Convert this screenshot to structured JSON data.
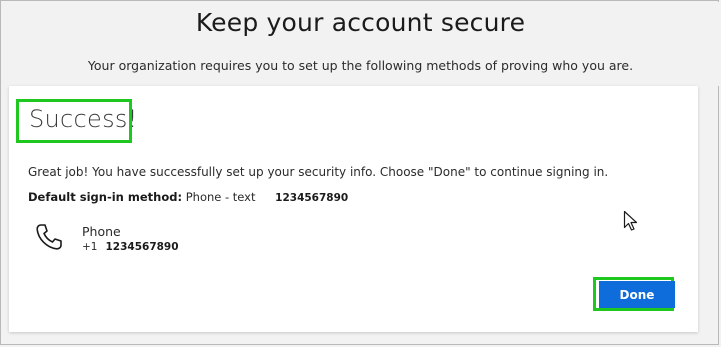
{
  "header": {
    "title": "Keep your account secure",
    "subtitle": "Your organization requires you to set up the following methods of proving who you are."
  },
  "card": {
    "heading": "Success!",
    "message": "Great job! You have successfully set up your security info. Choose \"Done\" to continue signing in.",
    "default_method": {
      "label": "Default sign-in method:",
      "value": "Phone - text",
      "number": "1234567890"
    },
    "phone": {
      "label": "Phone",
      "country_code": "+1",
      "number": "1234567890"
    },
    "done_label": "Done"
  },
  "icons": {
    "phone": "phone-icon",
    "cursor": "mouse-pointer-icon"
  },
  "colors": {
    "highlight": "#1fc81f",
    "button": "#0f6cdb",
    "background": "#f2f2f2",
    "card": "#ffffff"
  }
}
